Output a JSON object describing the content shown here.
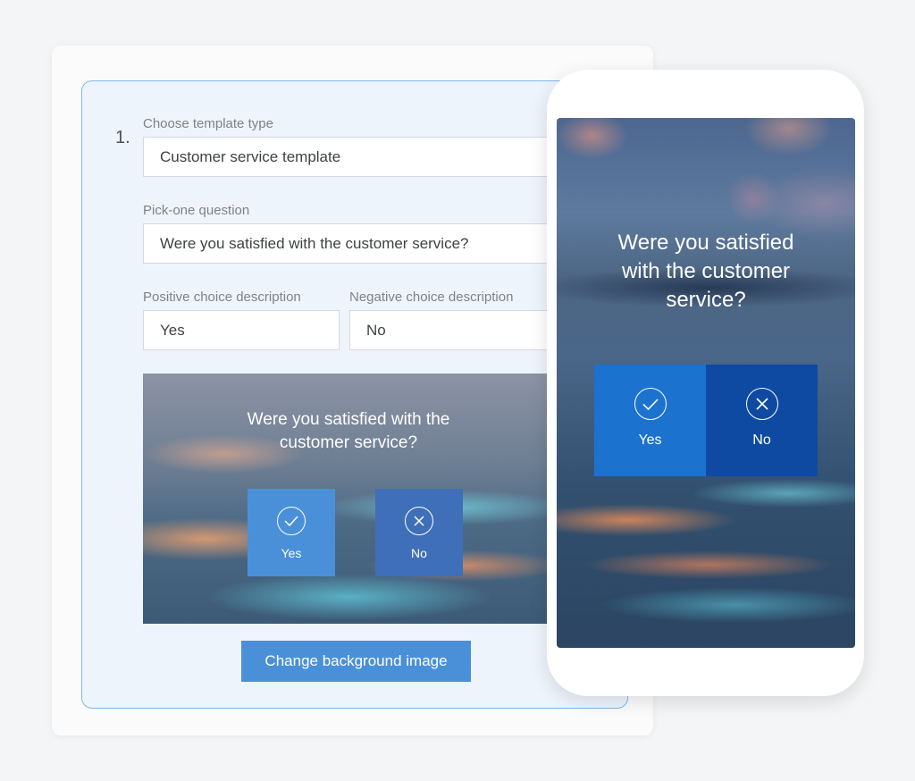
{
  "editor": {
    "step_number": "1.",
    "template_type": {
      "label": "Choose template type",
      "value": "Customer service template"
    },
    "question": {
      "label": "Pick-one question",
      "value": "Were you satisfied with the customer service?"
    },
    "positive_choice": {
      "label": "Positive choice description",
      "value": "Yes"
    },
    "negative_choice": {
      "label": "Negative choice description",
      "value": "No"
    },
    "preview": {
      "question": "Were you satisfied with the customer service?",
      "yes_label": "Yes",
      "no_label": "No",
      "yes_icon": "check-circle-icon",
      "no_icon": "x-circle-icon"
    },
    "change_background_label": "Change background image"
  },
  "phone": {
    "question": "Were you satisfied with the customer service?",
    "yes_label": "Yes",
    "no_label": "No",
    "yes_icon": "check-circle-icon",
    "no_icon": "x-circle-icon"
  },
  "colors": {
    "accent": "#4a90d9",
    "panel_border": "#7ab8ec",
    "phone_yes": "#1c72cf",
    "phone_no": "#0f4aa2"
  }
}
